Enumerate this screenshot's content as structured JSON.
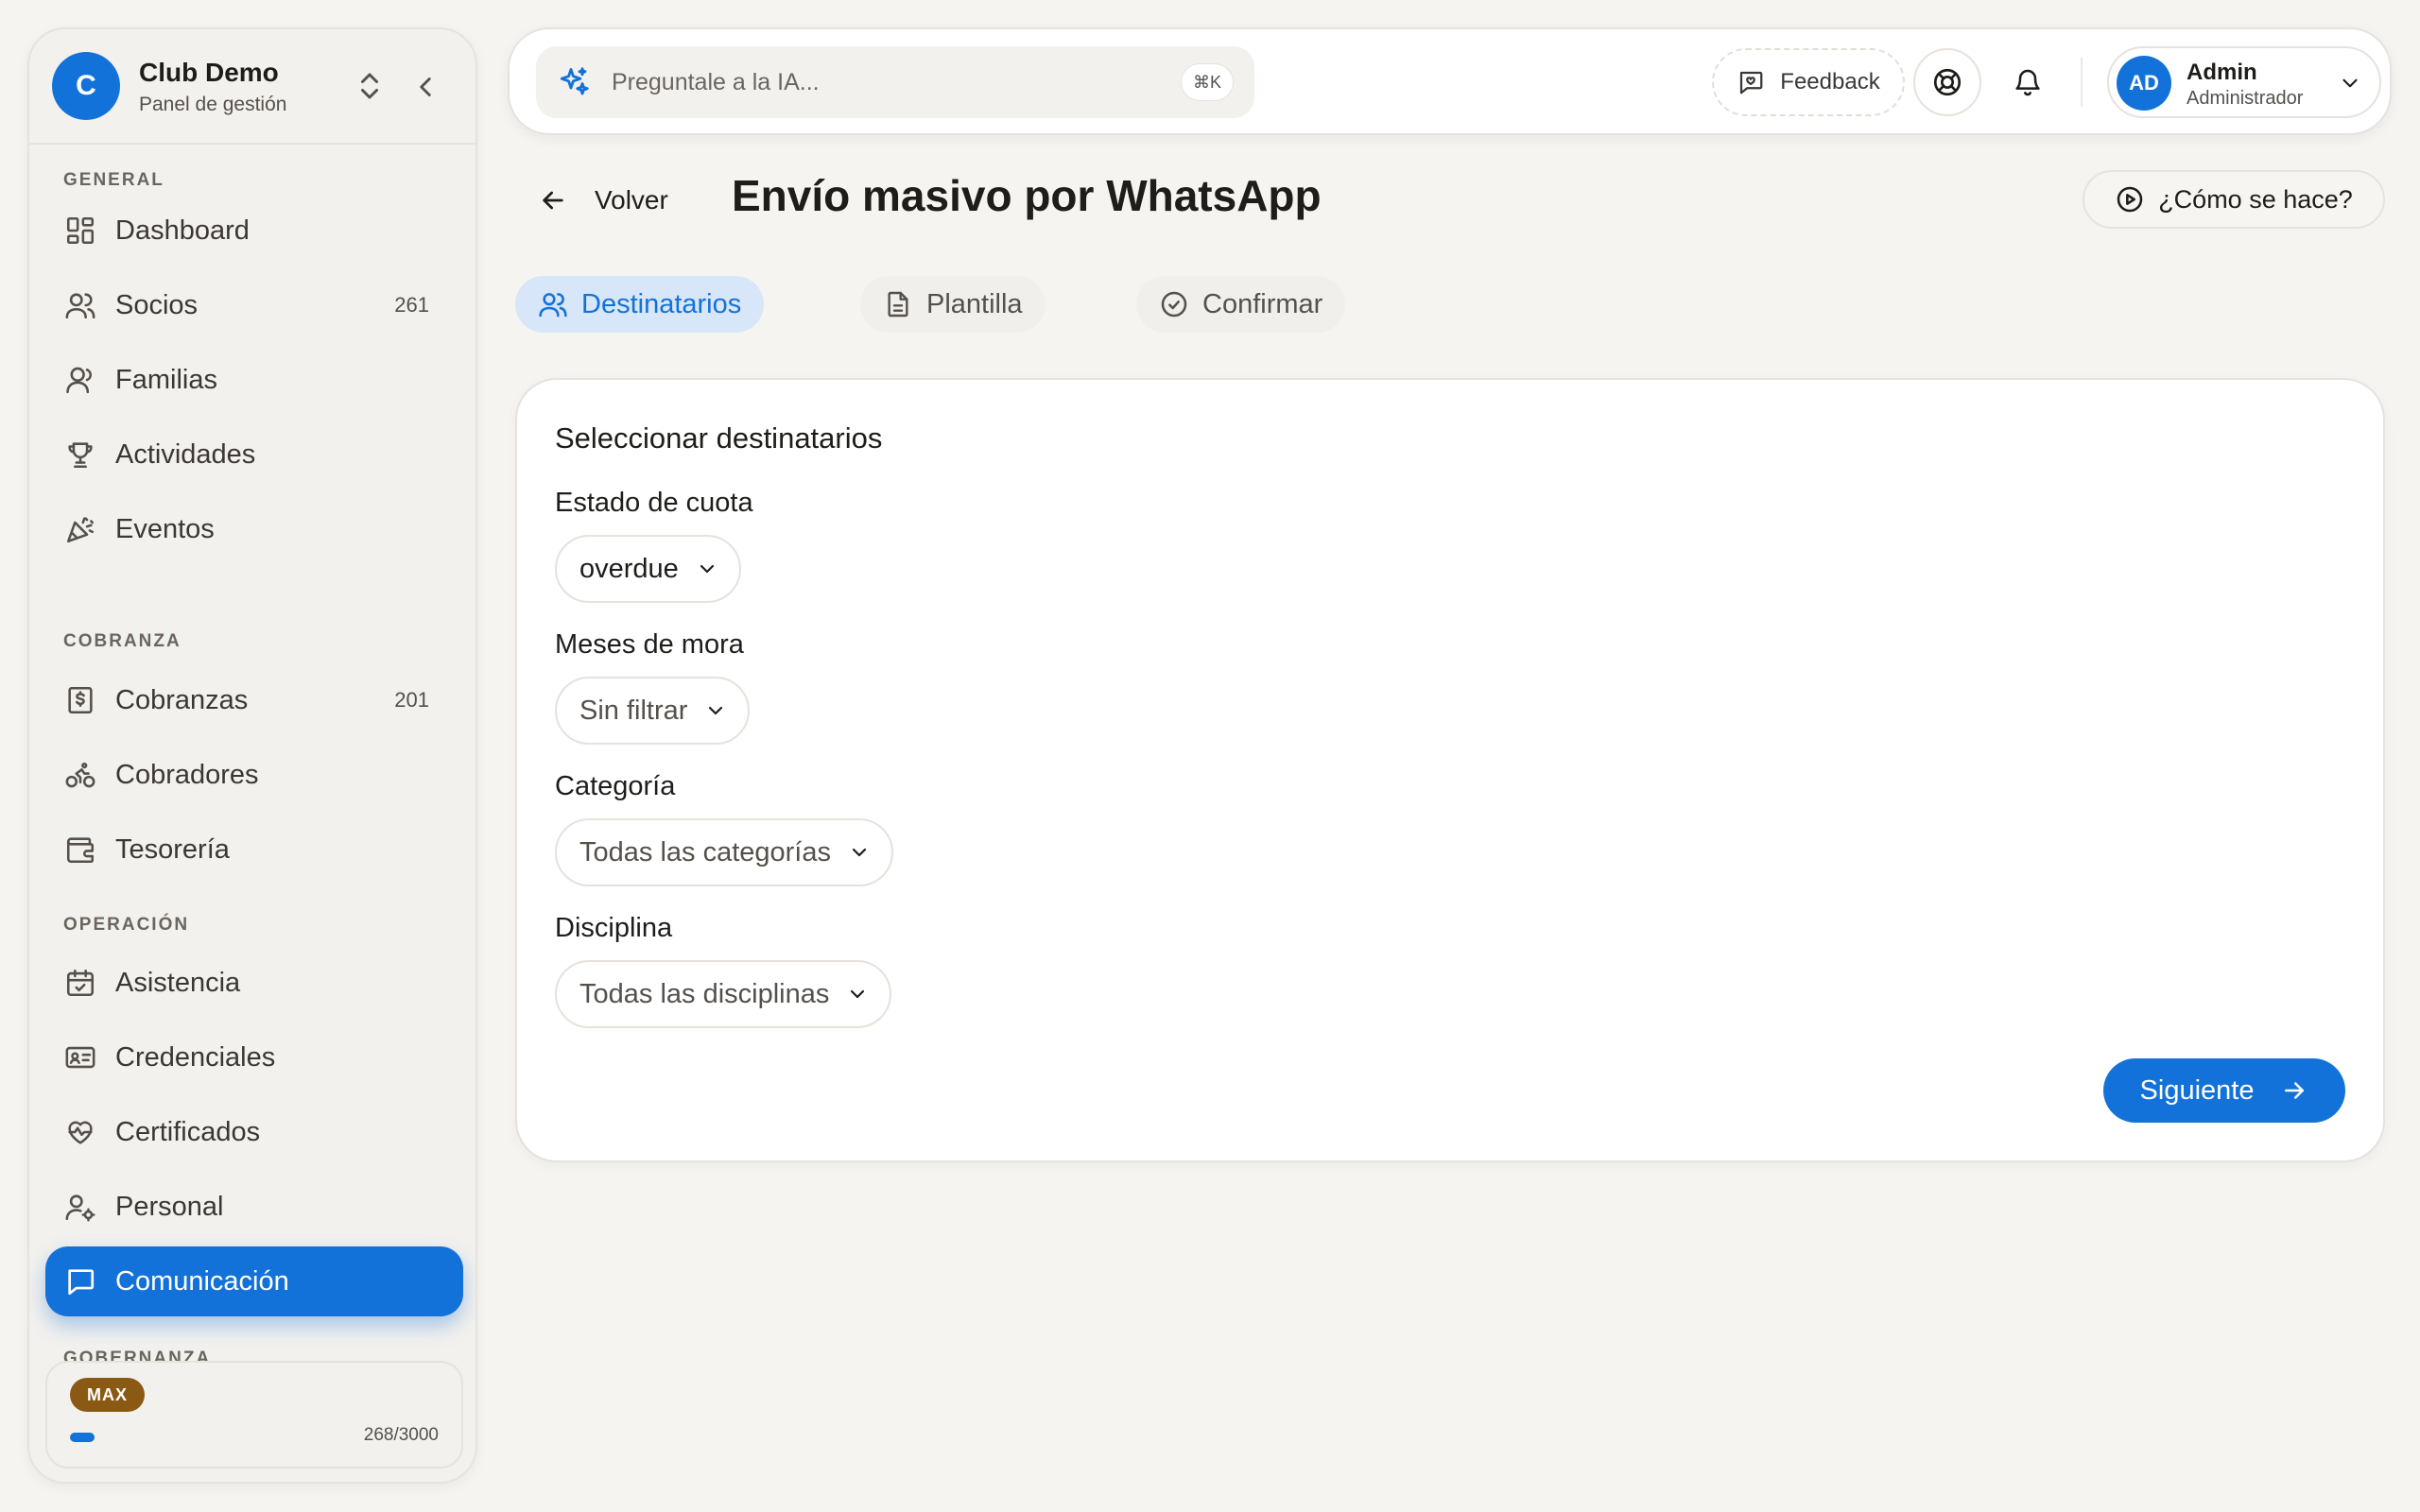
{
  "brand": {
    "initial": "C",
    "name": "Club Demo",
    "subtitle": "Panel de gestión"
  },
  "sidebar": {
    "sections": [
      {
        "label": "GENERAL"
      },
      {
        "label": "COBRANZA"
      },
      {
        "label": "OPERACIÓN"
      },
      {
        "label": "GOBERNANZA"
      }
    ],
    "items": [
      {
        "label": "Dashboard",
        "icon": "dashboard-icon"
      },
      {
        "label": "Socios",
        "count": "261",
        "icon": "users-icon"
      },
      {
        "label": "Familias",
        "icon": "family-icon"
      },
      {
        "label": "Actividades",
        "icon": "trophy-icon"
      },
      {
        "label": "Eventos",
        "icon": "party-popper-icon"
      },
      {
        "label": "Cobranzas",
        "count": "201",
        "icon": "receipt-icon"
      },
      {
        "label": "Cobradores",
        "icon": "bike-icon"
      },
      {
        "label": "Tesorería",
        "icon": "wallet-icon"
      },
      {
        "label": "Asistencia",
        "icon": "calendar-check-icon"
      },
      {
        "label": "Credenciales",
        "icon": "id-card-icon"
      },
      {
        "label": "Certificados",
        "icon": "heart-pulse-icon"
      },
      {
        "label": "Personal",
        "icon": "user-gear-icon"
      },
      {
        "label": "Comunicación",
        "icon": "message-icon",
        "active": true
      }
    ],
    "plan": {
      "badge": "MAX",
      "usage": "268/3000",
      "usage_fraction": 0.0893
    }
  },
  "topbar": {
    "search_placeholder": "Preguntale a la IA...",
    "shortcut": "⌘K",
    "feedback_label": "Feedback",
    "user": {
      "initials": "AD",
      "name": "Admin",
      "role": "Administrador"
    }
  },
  "page": {
    "back_label": "Volver",
    "title": "Envío masivo por WhatsApp",
    "howto_label": "¿Cómo se hace?",
    "steps": [
      {
        "label": "Destinatarios",
        "active": true
      },
      {
        "label": "Plantilla"
      },
      {
        "label": "Confirmar"
      }
    ]
  },
  "form": {
    "title": "Seleccionar destinatarios",
    "fields": [
      {
        "label": "Estado de cuota",
        "value": "overdue"
      },
      {
        "label": "Meses de mora",
        "value": "Sin filtrar"
      },
      {
        "label": "Categoría",
        "value": "Todas las categorías"
      },
      {
        "label": "Disciplina",
        "value": "Todas las disciplinas"
      }
    ],
    "next_label": "Siguiente"
  },
  "colors": {
    "accent": "#1372d9",
    "background": "#f6f4f1",
    "plan_badge": "#8a5a14"
  }
}
